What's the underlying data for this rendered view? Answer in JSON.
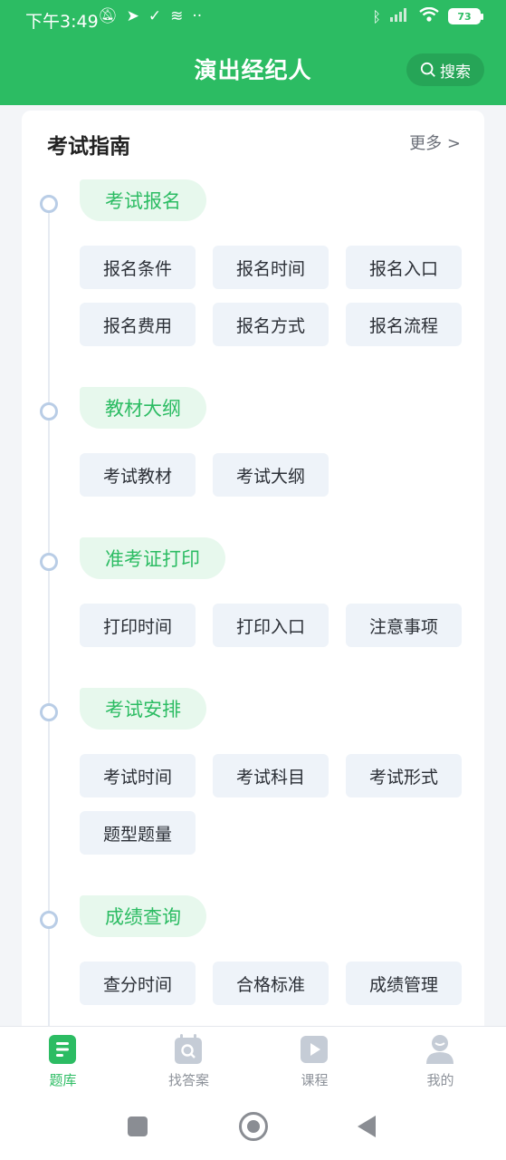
{
  "status_bar": {
    "time": "下午3:49",
    "battery": "73",
    "left_icons": [
      "bell-off-icon",
      "telegram-icon",
      "checkmark-icon",
      "layers-icon",
      "more-dots-icon"
    ],
    "right_icons": [
      "bluetooth-icon",
      "signal-icon",
      "wifi-icon",
      "battery-icon"
    ]
  },
  "header": {
    "title": "演出经纪人",
    "search_label": "搜索"
  },
  "guide": {
    "title": "考试指南",
    "more_label": "更多 >",
    "sections": [
      {
        "title": "考试报名",
        "items": [
          "报名条件",
          "报名时间",
          "报名入口",
          "报名费用",
          "报名方式",
          "报名流程"
        ]
      },
      {
        "title": "教材大纲",
        "items": [
          "考试教材",
          "考试大纲"
        ]
      },
      {
        "title": "准考证打印",
        "items": [
          "打印时间",
          "打印入口",
          "注意事项"
        ]
      },
      {
        "title": "考试安排",
        "items": [
          "考试时间",
          "考试科目",
          "考试形式",
          "题型题量"
        ]
      },
      {
        "title": "成绩查询",
        "items": [
          "查分时间",
          "合格标准",
          "成绩管理"
        ]
      }
    ]
  },
  "tabbar": {
    "tabs": [
      {
        "label": "题库",
        "icon": "question-bank-icon",
        "active": true
      },
      {
        "label": "找答案",
        "icon": "find-answer-icon",
        "active": false
      },
      {
        "label": "课程",
        "icon": "course-play-icon",
        "active": false
      },
      {
        "label": "我的",
        "icon": "profile-icon",
        "active": false
      }
    ]
  },
  "colors": {
    "brand": "#2cbc63",
    "tag_bg": "#eef3f9",
    "section_bg": "#e7f8ed"
  }
}
